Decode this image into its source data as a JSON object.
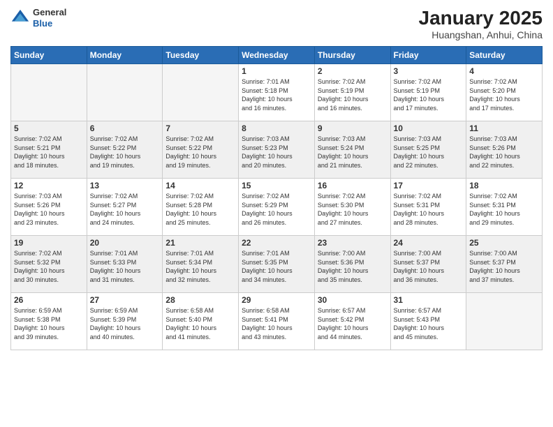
{
  "header": {
    "logo_general": "General",
    "logo_blue": "Blue",
    "month_title": "January 2025",
    "location": "Huangshan, Anhui, China"
  },
  "weekdays": [
    "Sunday",
    "Monday",
    "Tuesday",
    "Wednesday",
    "Thursday",
    "Friday",
    "Saturday"
  ],
  "weeks": [
    {
      "shaded": false,
      "days": [
        {
          "number": "",
          "info": ""
        },
        {
          "number": "",
          "info": ""
        },
        {
          "number": "",
          "info": ""
        },
        {
          "number": "1",
          "info": "Sunrise: 7:01 AM\nSunset: 5:18 PM\nDaylight: 10 hours\nand 16 minutes."
        },
        {
          "number": "2",
          "info": "Sunrise: 7:02 AM\nSunset: 5:19 PM\nDaylight: 10 hours\nand 16 minutes."
        },
        {
          "number": "3",
          "info": "Sunrise: 7:02 AM\nSunset: 5:19 PM\nDaylight: 10 hours\nand 17 minutes."
        },
        {
          "number": "4",
          "info": "Sunrise: 7:02 AM\nSunset: 5:20 PM\nDaylight: 10 hours\nand 17 minutes."
        }
      ]
    },
    {
      "shaded": true,
      "days": [
        {
          "number": "5",
          "info": "Sunrise: 7:02 AM\nSunset: 5:21 PM\nDaylight: 10 hours\nand 18 minutes."
        },
        {
          "number": "6",
          "info": "Sunrise: 7:02 AM\nSunset: 5:22 PM\nDaylight: 10 hours\nand 19 minutes."
        },
        {
          "number": "7",
          "info": "Sunrise: 7:02 AM\nSunset: 5:22 PM\nDaylight: 10 hours\nand 19 minutes."
        },
        {
          "number": "8",
          "info": "Sunrise: 7:03 AM\nSunset: 5:23 PM\nDaylight: 10 hours\nand 20 minutes."
        },
        {
          "number": "9",
          "info": "Sunrise: 7:03 AM\nSunset: 5:24 PM\nDaylight: 10 hours\nand 21 minutes."
        },
        {
          "number": "10",
          "info": "Sunrise: 7:03 AM\nSunset: 5:25 PM\nDaylight: 10 hours\nand 22 minutes."
        },
        {
          "number": "11",
          "info": "Sunrise: 7:03 AM\nSunset: 5:26 PM\nDaylight: 10 hours\nand 22 minutes."
        }
      ]
    },
    {
      "shaded": false,
      "days": [
        {
          "number": "12",
          "info": "Sunrise: 7:03 AM\nSunset: 5:26 PM\nDaylight: 10 hours\nand 23 minutes."
        },
        {
          "number": "13",
          "info": "Sunrise: 7:02 AM\nSunset: 5:27 PM\nDaylight: 10 hours\nand 24 minutes."
        },
        {
          "number": "14",
          "info": "Sunrise: 7:02 AM\nSunset: 5:28 PM\nDaylight: 10 hours\nand 25 minutes."
        },
        {
          "number": "15",
          "info": "Sunrise: 7:02 AM\nSunset: 5:29 PM\nDaylight: 10 hours\nand 26 minutes."
        },
        {
          "number": "16",
          "info": "Sunrise: 7:02 AM\nSunset: 5:30 PM\nDaylight: 10 hours\nand 27 minutes."
        },
        {
          "number": "17",
          "info": "Sunrise: 7:02 AM\nSunset: 5:31 PM\nDaylight: 10 hours\nand 28 minutes."
        },
        {
          "number": "18",
          "info": "Sunrise: 7:02 AM\nSunset: 5:31 PM\nDaylight: 10 hours\nand 29 minutes."
        }
      ]
    },
    {
      "shaded": true,
      "days": [
        {
          "number": "19",
          "info": "Sunrise: 7:02 AM\nSunset: 5:32 PM\nDaylight: 10 hours\nand 30 minutes."
        },
        {
          "number": "20",
          "info": "Sunrise: 7:01 AM\nSunset: 5:33 PM\nDaylight: 10 hours\nand 31 minutes."
        },
        {
          "number": "21",
          "info": "Sunrise: 7:01 AM\nSunset: 5:34 PM\nDaylight: 10 hours\nand 32 minutes."
        },
        {
          "number": "22",
          "info": "Sunrise: 7:01 AM\nSunset: 5:35 PM\nDaylight: 10 hours\nand 34 minutes."
        },
        {
          "number": "23",
          "info": "Sunrise: 7:00 AM\nSunset: 5:36 PM\nDaylight: 10 hours\nand 35 minutes."
        },
        {
          "number": "24",
          "info": "Sunrise: 7:00 AM\nSunset: 5:37 PM\nDaylight: 10 hours\nand 36 minutes."
        },
        {
          "number": "25",
          "info": "Sunrise: 7:00 AM\nSunset: 5:37 PM\nDaylight: 10 hours\nand 37 minutes."
        }
      ]
    },
    {
      "shaded": false,
      "days": [
        {
          "number": "26",
          "info": "Sunrise: 6:59 AM\nSunset: 5:38 PM\nDaylight: 10 hours\nand 39 minutes."
        },
        {
          "number": "27",
          "info": "Sunrise: 6:59 AM\nSunset: 5:39 PM\nDaylight: 10 hours\nand 40 minutes."
        },
        {
          "number": "28",
          "info": "Sunrise: 6:58 AM\nSunset: 5:40 PM\nDaylight: 10 hours\nand 41 minutes."
        },
        {
          "number": "29",
          "info": "Sunrise: 6:58 AM\nSunset: 5:41 PM\nDaylight: 10 hours\nand 43 minutes."
        },
        {
          "number": "30",
          "info": "Sunrise: 6:57 AM\nSunset: 5:42 PM\nDaylight: 10 hours\nand 44 minutes."
        },
        {
          "number": "31",
          "info": "Sunrise: 6:57 AM\nSunset: 5:43 PM\nDaylight: 10 hours\nand 45 minutes."
        },
        {
          "number": "",
          "info": ""
        }
      ]
    }
  ]
}
